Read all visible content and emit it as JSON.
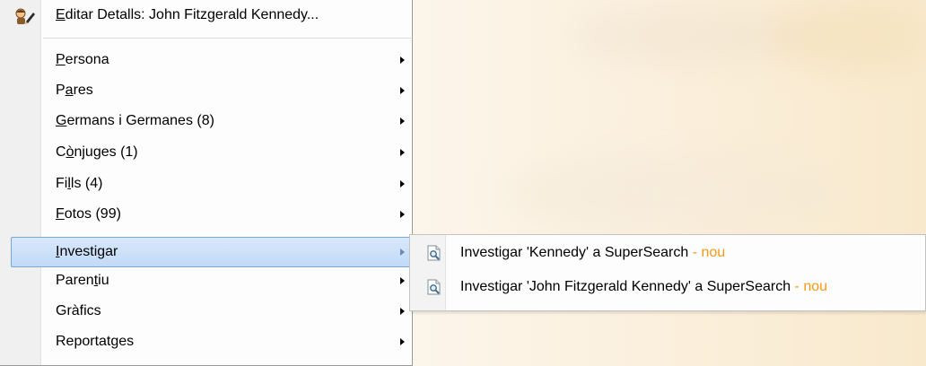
{
  "context_menu": {
    "items": [
      {
        "pre": "",
        "key": "E",
        "post": "ditar Detalls: John Fitzgerald Kennedy...",
        "has_submenu": false
      },
      {
        "pre": "",
        "key": "P",
        "post": "ersona",
        "has_submenu": true
      },
      {
        "pre": "P",
        "key": "a",
        "post": "res",
        "has_submenu": true
      },
      {
        "pre": "",
        "key": "G",
        "post": "ermans i Germanes (8)",
        "has_submenu": true
      },
      {
        "pre": "C",
        "key": "ò",
        "post": "njuges (1)",
        "has_submenu": true
      },
      {
        "pre": "Fi",
        "key": "l",
        "post": "ls (4)",
        "has_submenu": true
      },
      {
        "pre": "",
        "key": "F",
        "post": "otos (99)",
        "has_submenu": true
      },
      {
        "pre": "",
        "key": "I",
        "post": "nvestigar",
        "has_submenu": true
      },
      {
        "pre": "Paren",
        "key": "t",
        "post": "iu",
        "has_submenu": true
      },
      {
        "pre": "Gràfics",
        "key": "",
        "post": "",
        "has_submenu": true
      },
      {
        "pre": "Reportatges",
        "key": "",
        "post": "",
        "has_submenu": true
      }
    ],
    "highlighted_item": "Investigar",
    "edit_icon": "edit-person-icon"
  },
  "submenu": {
    "items": [
      {
        "label": "Investigar 'Kennedy' a SuperSearch",
        "badge": " - nou",
        "icon": "search-document-icon"
      },
      {
        "label": "Investigar 'John Fitzgerald Kennedy' a SuperSearch",
        "badge": " - nou",
        "icon": "search-document-icon"
      }
    ]
  },
  "colors": {
    "highlight_bg": "#c8dcf5",
    "highlight_border": "#7aa7da",
    "badge": "#f59a17"
  }
}
